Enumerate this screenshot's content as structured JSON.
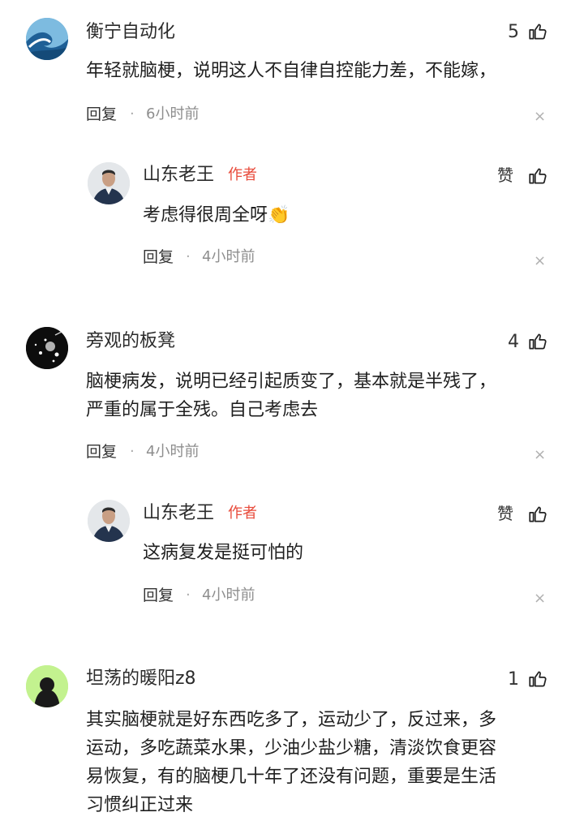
{
  "comments": [
    {
      "user": "衡宁自动化",
      "likes": "5",
      "text": "年轻就脑梗，说明这人不自律自控能力差，不能嫁，",
      "reply_label": "回复",
      "time": "6小时前",
      "reply": {
        "user": "山东老王",
        "tag": "作者",
        "like_label": "赞",
        "text": "考虑得很周全呀",
        "emoji": "👏",
        "reply_label": "回复",
        "time": "4小时前"
      }
    },
    {
      "user": "旁观的板凳",
      "likes": "4",
      "text_lines": [
        "脑梗病发，说明已经引起质变了，基本就是半残了，",
        "严重的属于全残。自己考虑去"
      ],
      "reply_label": "回复",
      "time": "4小时前",
      "reply": {
        "user": "山东老王",
        "tag": "作者",
        "like_label": "赞",
        "text": "这病复发是挺可怕的",
        "reply_label": "回复",
        "time": "4小时前"
      }
    },
    {
      "user": "坦荡的暖阳z8",
      "likes": "1",
      "text_lines": [
        "其实脑梗就是好东西吃多了，运动少了，反过来，多",
        "运动，多吃蔬菜水果，少油少盐少糖，清淡饮食更容",
        "易恢复，有的脑梗几十年了还没有问题，重要是生活",
        "习惯纠正过来"
      ]
    }
  ],
  "separator": "·",
  "close_glyph": "×",
  "icons": {
    "thumb": "thumbs-up-icon",
    "close": "close-icon"
  },
  "colors": {
    "author_tag": "#e84a3a",
    "time": "#8e8e8e",
    "text": "#1f1f1f"
  }
}
